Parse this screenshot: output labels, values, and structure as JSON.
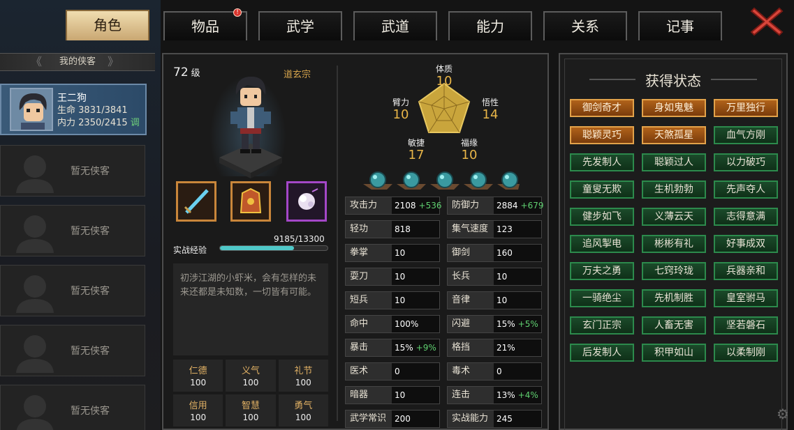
{
  "tabs": [
    {
      "label": "角色",
      "active": true
    },
    {
      "label": "物品",
      "active": false,
      "badge": "!"
    },
    {
      "label": "武学",
      "active": false
    },
    {
      "label": "武道",
      "active": false
    },
    {
      "label": "能力",
      "active": false
    },
    {
      "label": "关系",
      "active": false
    },
    {
      "label": "记事",
      "active": false
    }
  ],
  "sidebar": {
    "header": "我的侠客",
    "hero": {
      "name": "王二狗",
      "hp_label": "生命",
      "hp": "3831/3841",
      "mp_label": "内力",
      "mp": "2350/2415",
      "action": "调"
    },
    "empty_slots": [
      "暂无侠客",
      "暂无侠客",
      "暂无侠客",
      "暂无侠客",
      "暂无侠客"
    ]
  },
  "character": {
    "level_value": "72",
    "level_unit": "级",
    "sect": "道玄宗",
    "xp_label": "实战经验",
    "xp_text": "9185/13300",
    "xp_progress": 0.69,
    "description": "初涉江湖的小虾米，会有怎样的未来还都是未知数，一切皆有可能。",
    "virtues": [
      {
        "name": "仁德",
        "value": "100"
      },
      {
        "name": "义气",
        "value": "100"
      },
      {
        "name": "礼节",
        "value": "100"
      },
      {
        "name": "信用",
        "value": "100"
      },
      {
        "name": "智慧",
        "value": "100"
      },
      {
        "name": "勇气",
        "value": "100"
      }
    ]
  },
  "attributes": {
    "tizhi": {
      "label": "体质",
      "value": "10"
    },
    "wuxing": {
      "label": "悟性",
      "value": "14"
    },
    "fuyuan": {
      "label": "福缘",
      "value": "10"
    },
    "minjie": {
      "label": "敏捷",
      "value": "17"
    },
    "bili": {
      "label": "臂力",
      "value": "10"
    }
  },
  "stats": [
    {
      "label": "攻击力",
      "value": "2108",
      "bonus": "+536"
    },
    {
      "label": "防御力",
      "value": "2884",
      "bonus": "+679"
    },
    {
      "label": "轻功",
      "value": "818",
      "bonus": ""
    },
    {
      "label": "集气速度",
      "value": "123",
      "bonus": ""
    },
    {
      "label": "拳掌",
      "value": "10",
      "bonus": ""
    },
    {
      "label": "御剑",
      "value": "160",
      "bonus": ""
    },
    {
      "label": "耍刀",
      "value": "10",
      "bonus": ""
    },
    {
      "label": "长兵",
      "value": "10",
      "bonus": ""
    },
    {
      "label": "短兵",
      "value": "10",
      "bonus": ""
    },
    {
      "label": "音律",
      "value": "10",
      "bonus": ""
    },
    {
      "label": "命中",
      "value": "100%",
      "bonus": ""
    },
    {
      "label": "闪避",
      "value": "15%",
      "bonus": "+5%"
    },
    {
      "label": "暴击",
      "value": "15%",
      "bonus": "+9%"
    },
    {
      "label": "格挡",
      "value": "21%",
      "bonus": ""
    },
    {
      "label": "医术",
      "value": "0",
      "bonus": ""
    },
    {
      "label": "毒术",
      "value": "0",
      "bonus": ""
    },
    {
      "label": "暗器",
      "value": "10",
      "bonus": ""
    },
    {
      "label": "连击",
      "value": "13%",
      "bonus": "+4%"
    },
    {
      "label": "武学常识",
      "value": "200",
      "bonus": ""
    },
    {
      "label": "实战能力",
      "value": "245",
      "bonus": ""
    }
  ],
  "status_panel": {
    "title": "获得状态",
    "items": [
      {
        "label": "御剑奇才",
        "tier": "gold"
      },
      {
        "label": "身如鬼魅",
        "tier": "gold"
      },
      {
        "label": "万里独行",
        "tier": "gold"
      },
      {
        "label": "聪颖灵巧",
        "tier": "gold"
      },
      {
        "label": "天煞孤星",
        "tier": "gold"
      },
      {
        "label": "血气方刚",
        "tier": "green"
      },
      {
        "label": "先发制人",
        "tier": "green"
      },
      {
        "label": "聪颖过人",
        "tier": "green"
      },
      {
        "label": "以力破巧",
        "tier": "green"
      },
      {
        "label": "童叟无欺",
        "tier": "green"
      },
      {
        "label": "生机勃勃",
        "tier": "green"
      },
      {
        "label": "先声夺人",
        "tier": "green"
      },
      {
        "label": "健步如飞",
        "tier": "green"
      },
      {
        "label": "义薄云天",
        "tier": "green"
      },
      {
        "label": "志得意满",
        "tier": "green"
      },
      {
        "label": "追风掣电",
        "tier": "green"
      },
      {
        "label": "彬彬有礼",
        "tier": "green"
      },
      {
        "label": "好事成双",
        "tier": "green"
      },
      {
        "label": "万夫之勇",
        "tier": "green"
      },
      {
        "label": "七窍玲珑",
        "tier": "green"
      },
      {
        "label": "兵器亲和",
        "tier": "green"
      },
      {
        "label": "一骑绝尘",
        "tier": "green"
      },
      {
        "label": "先机制胜",
        "tier": "green"
      },
      {
        "label": "皇室驸马",
        "tier": "green"
      },
      {
        "label": "玄门正宗",
        "tier": "green"
      },
      {
        "label": "人畜无害",
        "tier": "green"
      },
      {
        "label": "坚若磐石",
        "tier": "green"
      },
      {
        "label": "后发制人",
        "tier": "green"
      },
      {
        "label": "积甲如山",
        "tier": "green"
      },
      {
        "label": "以柔制刚",
        "tier": "green"
      }
    ]
  },
  "colors": {
    "accent_gold": "#e8b548",
    "bonus_green": "#5fd070",
    "status_gold": "#e2a24a",
    "status_green": "#2c8a4c",
    "xp_bar": "#4fc8c8"
  }
}
